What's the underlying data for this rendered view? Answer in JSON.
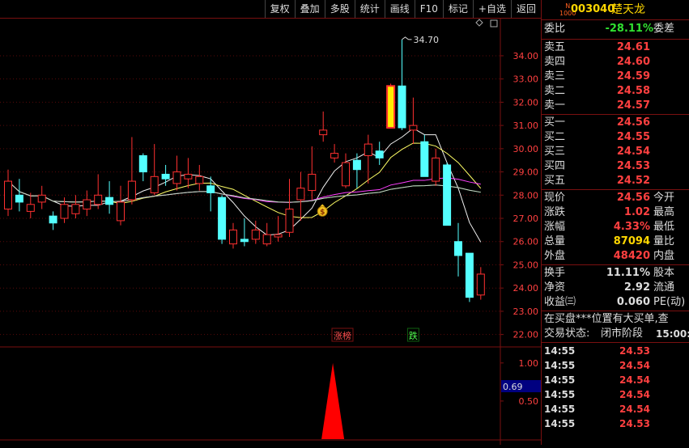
{
  "toolbar": {
    "buttons": [
      "复权",
      "叠加",
      "多股",
      "统计",
      "画线",
      "F10",
      "标记",
      "+自选",
      "返回"
    ]
  },
  "stock": {
    "code": "003040",
    "name": "楚天龙",
    "badge_top": "N",
    "badge_bottom": "1000"
  },
  "weibi": {
    "label": "委比",
    "value": "-28.11%",
    "label2": "委差"
  },
  "sell": [
    {
      "label": "卖五",
      "price": "24.61"
    },
    {
      "label": "卖四",
      "price": "24.60"
    },
    {
      "label": "卖三",
      "price": "24.59"
    },
    {
      "label": "卖二",
      "price": "24.58"
    },
    {
      "label": "卖一",
      "price": "24.57"
    }
  ],
  "buy": [
    {
      "label": "买一",
      "price": "24.56"
    },
    {
      "label": "买二",
      "price": "24.55"
    },
    {
      "label": "买三",
      "price": "24.54"
    },
    {
      "label": "买四",
      "price": "24.53"
    },
    {
      "label": "买五",
      "price": "24.52"
    }
  ],
  "quote": [
    {
      "label": "现价",
      "value": "24.56",
      "label2": "今开",
      "color": "red"
    },
    {
      "label": "涨跌",
      "value": "1.02",
      "label2": "最高",
      "color": "red"
    },
    {
      "label": "涨幅",
      "value": "4.33%",
      "label2": "最低",
      "color": "red"
    },
    {
      "label": "总量",
      "value": "87094",
      "label2": "量比",
      "color": "yellow"
    },
    {
      "label": "外盘",
      "value": "48420",
      "label2": "内盘",
      "color": "red"
    }
  ],
  "fund": [
    {
      "label": "换手",
      "value": "11.11%",
      "label2": "股本",
      "color": "white"
    },
    {
      "label": "净资",
      "value": "2.92",
      "label2": "流通",
      "color": "white"
    },
    {
      "label": "收益㈢",
      "value": "0.060",
      "label2": "PE(动)",
      "color": "white"
    }
  ],
  "notice": "在买盘***位置有大买单,查",
  "status": {
    "label": "交易状态:",
    "value": "闭市阶段",
    "time": "15:00:"
  },
  "ticks": [
    {
      "time": "14:55",
      "price": "24.53"
    },
    {
      "time": "14:55",
      "price": "24.54"
    },
    {
      "time": "14:55",
      "price": "24.54"
    },
    {
      "time": "14:55",
      "price": "24.54"
    },
    {
      "time": "14:55",
      "price": "24.54"
    },
    {
      "time": "14:55",
      "price": "24.53"
    }
  ],
  "chart_data": {
    "type": "candlestick",
    "y_ticks": [
      "34.00",
      "33.00",
      "32.00",
      "31.00",
      "30.00",
      "29.00",
      "28.00",
      "27.00",
      "26.00",
      "25.00",
      "24.00",
      "23.00",
      "22.00"
    ],
    "ylim": [
      21.5,
      35.6
    ],
    "high_annotation": "34.70",
    "markers": [
      {
        "index": 30,
        "text": "涨榜"
      },
      {
        "index": 36,
        "text": "跌"
      }
    ],
    "candles": [
      {
        "o": 27.4,
        "c": 28.6,
        "h": 29.1,
        "l": 27.1
      },
      {
        "o": 28.0,
        "c": 27.7,
        "h": 28.7,
        "l": 27.3
      },
      {
        "o": 27.3,
        "c": 27.6,
        "h": 28.1,
        "l": 27.0
      },
      {
        "o": 27.7,
        "c": 28.0,
        "h": 28.4,
        "l": 27.4
      },
      {
        "o": 27.1,
        "c": 26.8,
        "h": 27.3,
        "l": 26.5
      },
      {
        "o": 27.0,
        "c": 27.6,
        "h": 27.9,
        "l": 26.8
      },
      {
        "o": 27.2,
        "c": 27.6,
        "h": 28.0,
        "l": 27.0
      },
      {
        "o": 27.4,
        "c": 27.8,
        "h": 28.2,
        "l": 27.1
      },
      {
        "o": 27.6,
        "c": 28.0,
        "h": 28.9,
        "l": 27.4
      },
      {
        "o": 27.9,
        "c": 27.6,
        "h": 28.6,
        "l": 27.2
      },
      {
        "o": 26.9,
        "c": 27.7,
        "h": 28.4,
        "l": 26.7
      },
      {
        "o": 27.8,
        "c": 28.6,
        "h": 30.5,
        "l": 27.6
      },
      {
        "o": 29.7,
        "c": 29.0,
        "h": 29.8,
        "l": 28.6
      },
      {
        "o": 28.1,
        "c": 28.8,
        "h": 30.2,
        "l": 28.0
      },
      {
        "o": 28.9,
        "c": 28.7,
        "h": 29.3,
        "l": 28.4
      },
      {
        "o": 28.5,
        "c": 29.0,
        "h": 29.7,
        "l": 28.2
      },
      {
        "o": 28.7,
        "c": 28.9,
        "h": 29.6,
        "l": 28.3
      },
      {
        "o": 28.5,
        "c": 28.8,
        "h": 29.3,
        "l": 28.2
      },
      {
        "o": 28.4,
        "c": 28.1,
        "h": 28.8,
        "l": 27.3
      },
      {
        "o": 27.9,
        "c": 26.1,
        "h": 28.0,
        "l": 25.9
      },
      {
        "o": 25.9,
        "c": 26.5,
        "h": 26.8,
        "l": 25.7
      },
      {
        "o": 26.1,
        "c": 26.0,
        "h": 27.0,
        "l": 25.8
      },
      {
        "o": 26.1,
        "c": 26.5,
        "h": 26.9,
        "l": 25.9
      },
      {
        "o": 25.9,
        "c": 26.3,
        "h": 26.8,
        "l": 25.8
      },
      {
        "o": 26.2,
        "c": 26.3,
        "h": 27.1,
        "l": 26.0
      },
      {
        "o": 26.4,
        "c": 27.4,
        "h": 28.7,
        "l": 26.2
      },
      {
        "o": 27.8,
        "c": 28.3,
        "h": 29.0,
        "l": 26.9
      },
      {
        "o": 28.2,
        "c": 28.9,
        "h": 30.1,
        "l": 27.8
      },
      {
        "o": 30.6,
        "c": 30.8,
        "h": 31.6,
        "l": 30.3
      },
      {
        "o": 29.6,
        "c": 29.8,
        "h": 30.2,
        "l": 29.4
      },
      {
        "o": 28.4,
        "c": 29.4,
        "h": 29.8,
        "l": 28.3
      },
      {
        "o": 29.5,
        "c": 29.1,
        "h": 29.8,
        "l": 28.3
      },
      {
        "o": 29.7,
        "c": 30.2,
        "h": 30.6,
        "l": 28.5
      },
      {
        "o": 29.9,
        "c": 29.6,
        "h": 30.3,
        "l": 29.3
      },
      {
        "o": 30.9,
        "c": 32.7,
        "h": 32.8,
        "l": 30.9
      },
      {
        "o": 32.7,
        "c": 30.9,
        "h": 34.7,
        "l": 30.8
      },
      {
        "o": 30.8,
        "c": 31.0,
        "h": 32.2,
        "l": 30.2
      },
      {
        "o": 30.3,
        "c": 28.8,
        "h": 30.6,
        "l": 28.8
      },
      {
        "o": 28.6,
        "c": 29.6,
        "h": 30.0,
        "l": 28.4
      },
      {
        "o": 29.3,
        "c": 26.7,
        "h": 29.4,
        "l": 26.7
      },
      {
        "o": 26.0,
        "c": 25.4,
        "h": 26.8,
        "l": 24.5
      },
      {
        "o": 25.5,
        "c": 23.6,
        "h": 25.5,
        "l": 23.4
      },
      {
        "o": 23.7,
        "c": 24.6,
        "h": 24.9,
        "l": 23.5
      }
    ],
    "lower_panel": {
      "y_ticks": [
        "1.00",
        "0.50"
      ],
      "value_badge": "0.69",
      "ylim": [
        0,
        1.2
      ],
      "spike_value": 1.0
    }
  }
}
